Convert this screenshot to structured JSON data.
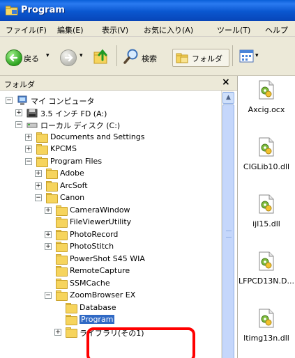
{
  "window": {
    "title": "Program",
    "menu": [
      "ファイル(F)",
      "編集(E)",
      "表示(V)",
      "お気に入り(A)",
      "ツール(T)",
      "ヘルプ"
    ]
  },
  "toolbar": {
    "back_label": "戻る",
    "search_label": "検索",
    "folders_label": "フォルダ"
  },
  "folders_pane": {
    "title": "フォルダ",
    "close": "×",
    "tree": [
      {
        "label": "マイ コンピュータ",
        "expander": "−"
      },
      {
        "label": "3.5 インチ FD (A:)",
        "expander": "+"
      },
      {
        "label": "ローカル ディスク (C:)",
        "expander": "−"
      },
      {
        "label": "Documents and Settings",
        "expander": "+"
      },
      {
        "label": "KPCMS",
        "expander": "+"
      },
      {
        "label": "Program Files",
        "expander": "−"
      },
      {
        "label": "Adobe",
        "expander": "+"
      },
      {
        "label": "ArcSoft",
        "expander": "+"
      },
      {
        "label": "Canon",
        "expander": "−"
      },
      {
        "label": "CameraWindow",
        "expander": "+"
      },
      {
        "label": "FileViewerUtility",
        "expander": ""
      },
      {
        "label": "PhotoRecord",
        "expander": "+"
      },
      {
        "label": "PhotoStitch",
        "expander": "+"
      },
      {
        "label": "PowerShot S45 WIA",
        "expander": ""
      },
      {
        "label": "RemoteCapture",
        "expander": ""
      },
      {
        "label": "SSMCache",
        "expander": ""
      },
      {
        "label": "ZoomBrowser EX",
        "expander": "−"
      },
      {
        "label": "Database",
        "expander": ""
      },
      {
        "label": "Program",
        "expander": ""
      },
      {
        "label": "ライブラリ(その1)",
        "expander": "+"
      }
    ]
  },
  "files": [
    "Axcig.ocx",
    "CIGLib10.dll",
    "ijl15.dll",
    "LFPCD13N.D...",
    "ltimg13n.dll"
  ]
}
